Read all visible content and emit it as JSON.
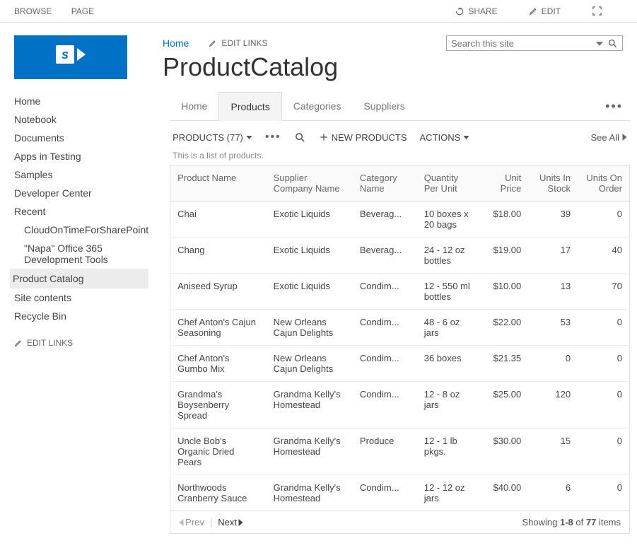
{
  "ribbon": {
    "browse": "BROWSE",
    "page": "PAGE",
    "share": "SHARE",
    "edit": "EDIT"
  },
  "header": {
    "home": "Home",
    "editLinks": "EDIT LINKS",
    "searchPlaceholder": "Search this site",
    "title": "ProductCatalog"
  },
  "sidenav": {
    "items": [
      {
        "label": "Home",
        "sub": false,
        "active": false
      },
      {
        "label": "Notebook",
        "sub": false,
        "active": false
      },
      {
        "label": "Documents",
        "sub": false,
        "active": false
      },
      {
        "label": "Apps in Testing",
        "sub": false,
        "active": false
      },
      {
        "label": "Samples",
        "sub": false,
        "active": false
      },
      {
        "label": "Developer Center",
        "sub": false,
        "active": false
      },
      {
        "label": "Recent",
        "sub": false,
        "active": false
      },
      {
        "label": "CloudOnTimeForSharePoint",
        "sub": true,
        "active": false
      },
      {
        "label": "\"Napa\" Office 365 Development Tools",
        "sub": true,
        "active": false
      },
      {
        "label": "Product Catalog",
        "sub": false,
        "active": true
      },
      {
        "label": "Site contents",
        "sub": false,
        "active": false
      },
      {
        "label": "Recycle Bin",
        "sub": false,
        "active": false
      }
    ],
    "editLinks": "EDIT LINKS"
  },
  "tabs": [
    {
      "label": "Home",
      "active": false
    },
    {
      "label": "Products",
      "active": true
    },
    {
      "label": "Categories",
      "active": false
    },
    {
      "label": "Suppliers",
      "active": false
    }
  ],
  "toolbar": {
    "title": "PRODUCTS (77)",
    "count": 77,
    "newLabel": "NEW PRODUCTS",
    "actionsLabel": "ACTIONS",
    "seeAll": "See All"
  },
  "list": {
    "description": "This is a list of products.",
    "columns": [
      {
        "label": "Product Name",
        "align": "left"
      },
      {
        "label": "Supplier Company Name",
        "align": "left"
      },
      {
        "label": "Category Name",
        "align": "left"
      },
      {
        "label": "Quantity Per Unit",
        "align": "left"
      },
      {
        "label": "Unit Price",
        "align": "right"
      },
      {
        "label": "Units In Stock",
        "align": "right"
      },
      {
        "label": "Units On Order",
        "align": "right"
      }
    ],
    "rows": [
      {
        "name": "Chai",
        "supplier": "Exotic Liquids",
        "category": "Beverag...",
        "qpu": "10 boxes x 20 bags",
        "price": "$18.00",
        "stock": "39",
        "order": "0"
      },
      {
        "name": "Chang",
        "supplier": "Exotic Liquids",
        "category": "Beverag...",
        "qpu": "24 - 12 oz bottles",
        "price": "$19.00",
        "stock": "17",
        "order": "40"
      },
      {
        "name": "Aniseed Syrup",
        "supplier": "Exotic Liquids",
        "category": "Condim...",
        "qpu": "12 - 550 ml bottles",
        "price": "$10.00",
        "stock": "13",
        "order": "70"
      },
      {
        "name": "Chef Anton's Cajun Seasoning",
        "supplier": "New Orleans Cajun Delights",
        "category": "Condim...",
        "qpu": "48 - 6 oz jars",
        "price": "$22.00",
        "stock": "53",
        "order": "0"
      },
      {
        "name": "Chef Anton's Gumbo Mix",
        "supplier": "New Orleans Cajun Delights",
        "category": "Condim...",
        "qpu": "36 boxes",
        "price": "$21.35",
        "stock": "0",
        "order": "0"
      },
      {
        "name": "Grandma's Boysenberry Spread",
        "supplier": "Grandma Kelly's Homestead",
        "category": "Condim...",
        "qpu": "12 - 8 oz jars",
        "price": "$25.00",
        "stock": "120",
        "order": "0"
      },
      {
        "name": "Uncle Bob's Organic Dried Pears",
        "supplier": "Grandma Kelly's Homestead",
        "category": "Produce",
        "qpu": "12 - 1 lb pkgs.",
        "price": "$30.00",
        "stock": "15",
        "order": "0"
      },
      {
        "name": "Northwoods Cranberry Sauce",
        "supplier": "Grandma Kelly's Homestead",
        "category": "Condim...",
        "qpu": "12 - 12 oz jars",
        "price": "$40.00",
        "stock": "6",
        "order": "0"
      }
    ]
  },
  "pager": {
    "prev": "Prev",
    "next": "Next",
    "summaryPrefix": "Showing ",
    "range": "1-8",
    "of": " of ",
    "total": "77",
    "suffix": " items"
  }
}
